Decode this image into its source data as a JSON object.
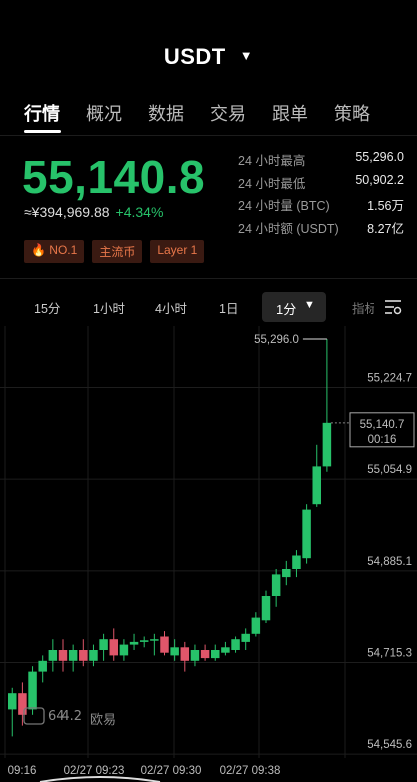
{
  "header": {
    "title": "USDT",
    "dropdown_icon": "caret-down-icon"
  },
  "tabs": [
    {
      "label": "行情",
      "active": true
    },
    {
      "label": "概况",
      "active": false
    },
    {
      "label": "数据",
      "active": false
    },
    {
      "label": "交易",
      "active": false
    },
    {
      "label": "跟单",
      "active": false
    },
    {
      "label": "策略",
      "active": false
    }
  ],
  "ticker": {
    "last_price": "55,140.8",
    "fiat_price": "≈¥394,969.88",
    "change": "+4.34%",
    "up_color": "#27c26a",
    "down_color": "#e0566a"
  },
  "tags": [
    {
      "label": "NO.1",
      "icon": "flame-icon"
    },
    {
      "label": "主流币"
    },
    {
      "label": "Layer 1"
    }
  ],
  "stats": [
    {
      "label": "24 小时最高",
      "value": "55,296.0"
    },
    {
      "label": "24 小时最低",
      "value": "50,902.2"
    },
    {
      "label": "24 小时量 (BTC)",
      "value": "1.56万"
    },
    {
      "label": "24 小时额 (USDT)",
      "value": "8.27亿"
    }
  ],
  "intervals": {
    "items": [
      "15分",
      "1小时",
      "4小时",
      "1日"
    ],
    "selected": "1分",
    "indicator_label": "指标",
    "settings_icon": "chart-settings-icon"
  },
  "chart_data": {
    "type": "candlestick",
    "y_ticks": [
      "55,224.7",
      "55,054.9",
      "54,885.1",
      "54,715.3",
      "54,545.6"
    ],
    "y_tick_values": [
      55224.7,
      55054.9,
      54885.1,
      54715.3,
      54545.6
    ],
    "x_ticks": [
      "09:16",
      "02/27 09:23",
      "02/27 09:30",
      "02/27 09:38"
    ],
    "high_marker": "55,296.0",
    "current_price": "55,140.7",
    "countdown": "00:16",
    "ylim": [
      54520,
      55320
    ],
    "candles": [
      {
        "o": 54610,
        "h": 54650,
        "l": 54560,
        "c": 54640
      },
      {
        "o": 54640,
        "h": 54660,
        "l": 54580,
        "c": 54600
      },
      {
        "o": 54610,
        "h": 54690,
        "l": 54600,
        "c": 54680
      },
      {
        "o": 54680,
        "h": 54710,
        "l": 54660,
        "c": 54700
      },
      {
        "o": 54700,
        "h": 54740,
        "l": 54680,
        "c": 54720
      },
      {
        "o": 54720,
        "h": 54740,
        "l": 54680,
        "c": 54700
      },
      {
        "o": 54700,
        "h": 54730,
        "l": 54680,
        "c": 54720
      },
      {
        "o": 54720,
        "h": 54740,
        "l": 54690,
        "c": 54700
      },
      {
        "o": 54700,
        "h": 54730,
        "l": 54690,
        "c": 54720
      },
      {
        "o": 54720,
        "h": 54750,
        "l": 54700,
        "c": 54740
      },
      {
        "o": 54740,
        "h": 54760,
        "l": 54700,
        "c": 54710
      },
      {
        "o": 54710,
        "h": 54740,
        "l": 54700,
        "c": 54730
      },
      {
        "o": 54730,
        "h": 54750,
        "l": 54720,
        "c": 54735
      },
      {
        "o": 54735,
        "h": 54745,
        "l": 54725,
        "c": 54738
      },
      {
        "o": 54738,
        "h": 54750,
        "l": 54710,
        "c": 54740
      },
      {
        "o": 54745,
        "h": 54755,
        "l": 54710,
        "c": 54715
      },
      {
        "o": 54710,
        "h": 54740,
        "l": 54700,
        "c": 54725
      },
      {
        "o": 54725,
        "h": 54735,
        "l": 54680,
        "c": 54700
      },
      {
        "o": 54700,
        "h": 54730,
        "l": 54690,
        "c": 54720
      },
      {
        "o": 54720,
        "h": 54730,
        "l": 54700,
        "c": 54705
      },
      {
        "o": 54705,
        "h": 54730,
        "l": 54700,
        "c": 54720
      },
      {
        "o": 54715,
        "h": 54735,
        "l": 54710,
        "c": 54725
      },
      {
        "o": 54720,
        "h": 54745,
        "l": 54715,
        "c": 54740
      },
      {
        "o": 54735,
        "h": 54760,
        "l": 54720,
        "c": 54750
      },
      {
        "o": 54750,
        "h": 54790,
        "l": 54745,
        "c": 54780
      },
      {
        "o": 54775,
        "h": 54830,
        "l": 54770,
        "c": 54820
      },
      {
        "o": 54820,
        "h": 54870,
        "l": 54800,
        "c": 54860
      },
      {
        "o": 54855,
        "h": 54885,
        "l": 54840,
        "c": 54870
      },
      {
        "o": 54870,
        "h": 54905,
        "l": 54855,
        "c": 54895
      },
      {
        "o": 54890,
        "h": 54990,
        "l": 54880,
        "c": 54980
      },
      {
        "o": 54990,
        "h": 55100,
        "l": 54985,
        "c": 55060
      },
      {
        "o": 55060,
        "h": 55296,
        "l": 55050,
        "c": 55140.7
      }
    ]
  },
  "watermark": {
    "text": "欧易",
    "left_text": "64",
    "right_text": "4.2"
  }
}
